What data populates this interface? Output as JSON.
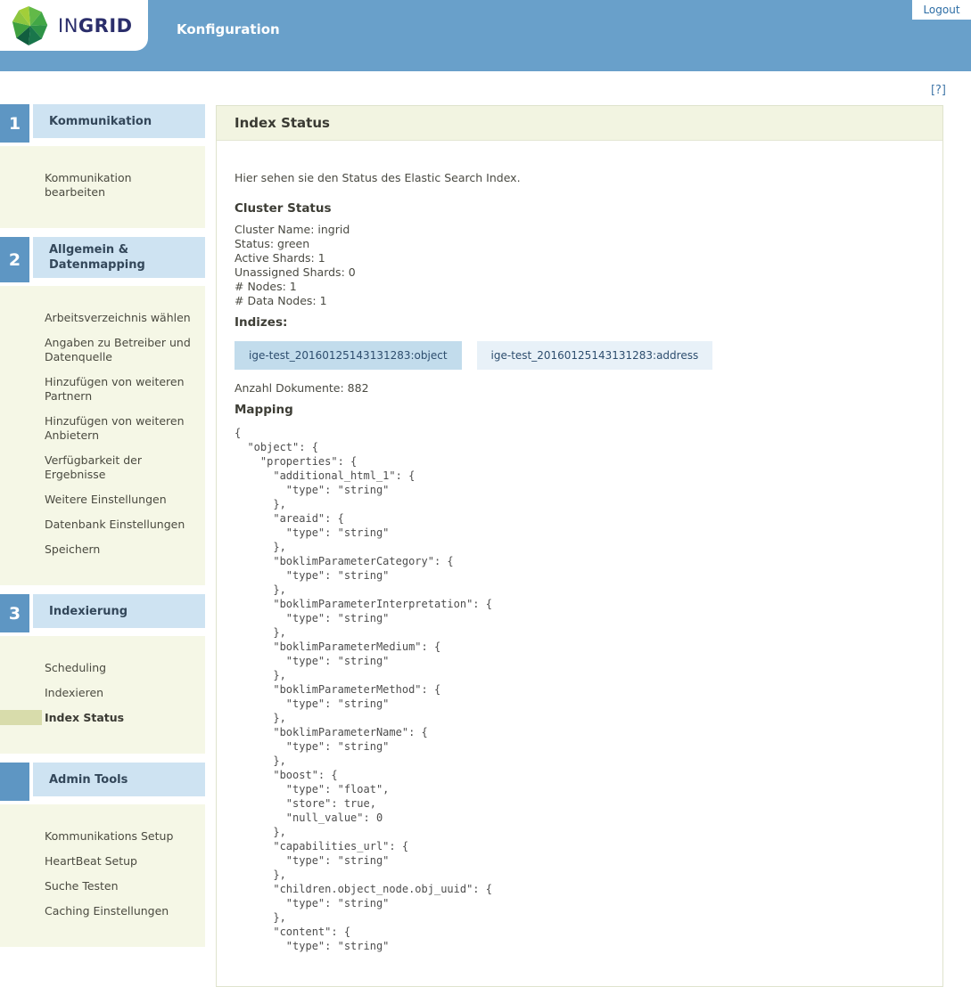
{
  "header": {
    "logo": {
      "text_regular": "IN",
      "text_bold": "GRID"
    },
    "app_title": "Konfiguration",
    "logout_label": "Logout"
  },
  "help_link_label": "[?]",
  "sidebar": {
    "sections": [
      {
        "number": "1",
        "title": "Kommunikation",
        "items": [
          {
            "id": "kommunikation-bearbeiten",
            "label": "Kommunikation bearbeiten",
            "active": false
          }
        ]
      },
      {
        "number": "2",
        "title": "Allgemein & Datenmapping",
        "items": [
          {
            "id": "arbeitsverzeichnis-waehlen",
            "label": "Arbeitsverzeichnis wählen",
            "active": false
          },
          {
            "id": "angaben-zu-betreiber-und-datenquelle",
            "label": "Angaben zu Betreiber und Datenquelle",
            "active": false
          },
          {
            "id": "hinzufuegen-von-weiteren-partnern",
            "label": "Hinzufügen von weiteren Partnern",
            "active": false
          },
          {
            "id": "hinzufuegen-von-weiteren-anbietern",
            "label": "Hinzufügen von weiteren Anbietern",
            "active": false
          },
          {
            "id": "verfuegbarkeit-der-ergebnisse",
            "label": "Verfügbarkeit der Ergebnisse",
            "active": false
          },
          {
            "id": "weitere-einstellungen",
            "label": "Weitere Einstellungen",
            "active": false
          },
          {
            "id": "datenbank-einstellungen",
            "label": "Datenbank Einstellungen",
            "active": false
          },
          {
            "id": "speichern",
            "label": "Speichern",
            "active": false
          }
        ]
      },
      {
        "number": "3",
        "title": "Indexierung",
        "items": [
          {
            "id": "scheduling",
            "label": "Scheduling",
            "active": false
          },
          {
            "id": "indexieren",
            "label": "Indexieren",
            "active": false
          },
          {
            "id": "index-status",
            "label": "Index Status",
            "active": true
          }
        ]
      },
      {
        "number": "",
        "title": "Admin Tools",
        "items": [
          {
            "id": "kommunikations-setup",
            "label": "Kommunikations Setup",
            "active": false
          },
          {
            "id": "heartbeat-setup",
            "label": "HeartBeat Setup",
            "active": false
          },
          {
            "id": "suche-testen",
            "label": "Suche Testen",
            "active": false
          },
          {
            "id": "caching-einstellungen",
            "label": "Caching Einstellungen",
            "active": false
          }
        ]
      }
    ]
  },
  "main": {
    "page_title": "Index Status",
    "intro": "Hier sehen sie den Status des Elastic Search Index.",
    "cluster": {
      "heading": "Cluster Status",
      "lines": [
        "Cluster Name: ingrid",
        "Status: green",
        "Active Shards: 1",
        "Unassigned Shards: 0",
        "# Nodes: 1",
        "# Data Nodes: 1"
      ]
    },
    "indizes_heading": "Indizes:",
    "index_buttons": [
      {
        "id": "object",
        "label": "ige-test_20160125143131283:object",
        "active": true
      },
      {
        "id": "address",
        "label": "ige-test_20160125143131283:address",
        "active": false
      }
    ],
    "documents_count": "Anzahl Dokumente: 882",
    "mapping_heading": "Mapping",
    "mapping_json": "{\n  \"object\": {\n    \"properties\": {\n      \"additional_html_1\": {\n        \"type\": \"string\"\n      },\n      \"areaid\": {\n        \"type\": \"string\"\n      },\n      \"boklimParameterCategory\": {\n        \"type\": \"string\"\n      },\n      \"boklimParameterInterpretation\": {\n        \"type\": \"string\"\n      },\n      \"boklimParameterMedium\": {\n        \"type\": \"string\"\n      },\n      \"boklimParameterMethod\": {\n        \"type\": \"string\"\n      },\n      \"boklimParameterName\": {\n        \"type\": \"string\"\n      },\n      \"boost\": {\n        \"type\": \"float\",\n        \"store\": true,\n        \"null_value\": 0\n      },\n      \"capabilities_url\": {\n        \"type\": \"string\"\n      },\n      \"children.object_node.obj_uuid\": {\n        \"type\": \"string\"\n      },\n      \"content\": {\n        \"type\": \"string\""
  },
  "colors": {
    "header_blue": "#69a0ca",
    "section_number_blue": "#5e96c3",
    "section_title_bg": "#cee3f2",
    "sidebar_items_bg": "#f5f7e6",
    "active_marker": "#d8dcab",
    "panel_title_bg": "#f2f4e1",
    "index_btn_active_bg": "#c2dcec",
    "index_btn_bg": "#e8f1f8",
    "link_blue": "#2d6da5",
    "logo_navy": "#2b2e6b"
  }
}
